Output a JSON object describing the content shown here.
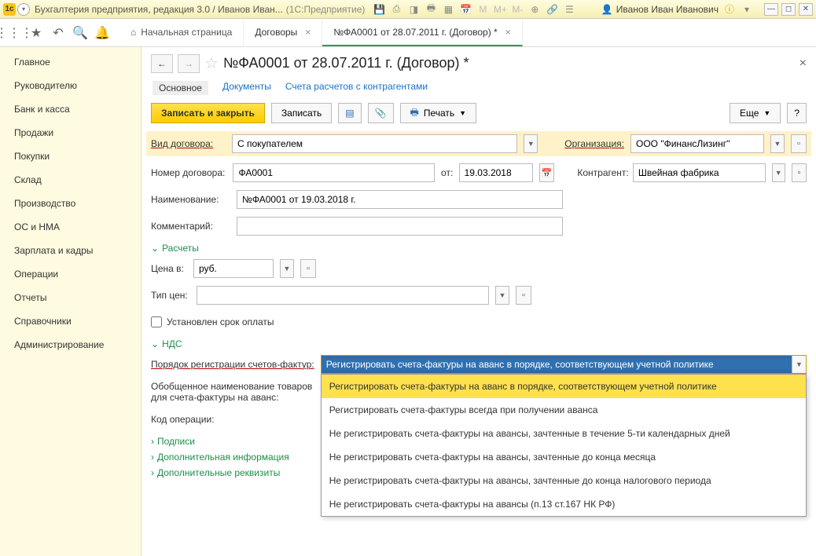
{
  "titlebar": {
    "app": "Бухгалтерия предприятия, редакция 3.0 / Иванов Иван...",
    "mode": "(1С:Предприятие)",
    "m": "M",
    "mp": "M+",
    "mm": "M-",
    "user": "Иванов Иван Иванович"
  },
  "tabs": {
    "home": "Начальная страница",
    "t1": "Договоры",
    "t2": "№ФА0001 от 28.07.2011 г. (Договор) *"
  },
  "sidebar": {
    "items": [
      "Главное",
      "Руководителю",
      "Банк и касса",
      "Продажи",
      "Покупки",
      "Склад",
      "Производство",
      "ОС и НМА",
      "Зарплата и кадры",
      "Операции",
      "Отчеты",
      "Справочники",
      "Администрирование"
    ]
  },
  "doc": {
    "title": "№ФА0001 от 28.07.2011 г. (Договор) *"
  },
  "subtabs": {
    "a": "Основное",
    "b": "Документы",
    "c": "Счета расчетов с контрагентами"
  },
  "btns": {
    "save_close": "Записать и закрыть",
    "save": "Записать",
    "print": "Печать",
    "more": "Еще",
    "help": "?"
  },
  "fields": {
    "vid_lbl": "Вид договора:",
    "vid_val": "С покупателем",
    "org_lbl": "Организация:",
    "org_val": "ООО \"ФинансЛизинг\"",
    "num_lbl": "Номер договора:",
    "num_val": "ФА0001",
    "ot": "от:",
    "date": "19.03.2018",
    "kontr_lbl": "Контрагент:",
    "kontr_val": "Швейная фабрика",
    "naim_lbl": "Наименование:",
    "naim_val": "№ФА0001 от 19.03.2018 г.",
    "komm_lbl": "Комментарий:",
    "komm_val": "",
    "raschety": "Расчеты",
    "cena_lbl": "Цена в:",
    "cena_val": "руб.",
    "tip_lbl": "Тип цен:",
    "tip_val": "",
    "srok": "Установлен срок оплаты",
    "nds": "НДС",
    "poryadok_lbl": "Порядок регистрации счетов-фактур:",
    "poryadok_val": "Регистрировать счета-фактуры на аванс в порядке, соответствующем учетной политике",
    "obob_lbl1": "Обобщенное наименование товаров",
    "obob_lbl2": "для счета-фактуры на аванс:",
    "kod_lbl": "Код операции:",
    "podpisi": "Подписи",
    "dopinfo": "Дополнительная информация",
    "doprekv": "Дополнительные реквизиты"
  },
  "dropdown": {
    "o0": "Регистрировать счета-фактуры на аванс в порядке, соответствующем учетной политике",
    "o1": "Регистрировать счета-фактуры всегда при получении аванса",
    "o2": "Не регистрировать счета-фактуры на авансы, зачтенные в течение 5-ти календарных дней",
    "o3": "Не регистрировать счета-фактуры на авансы, зачтенные до конца месяца",
    "o4": "Не регистрировать счета-фактуры на авансы, зачтенные до конца налогового периода",
    "o5": "Не регистрировать счета-фактуры на авансы (п.13 ст.167 НК РФ)"
  }
}
